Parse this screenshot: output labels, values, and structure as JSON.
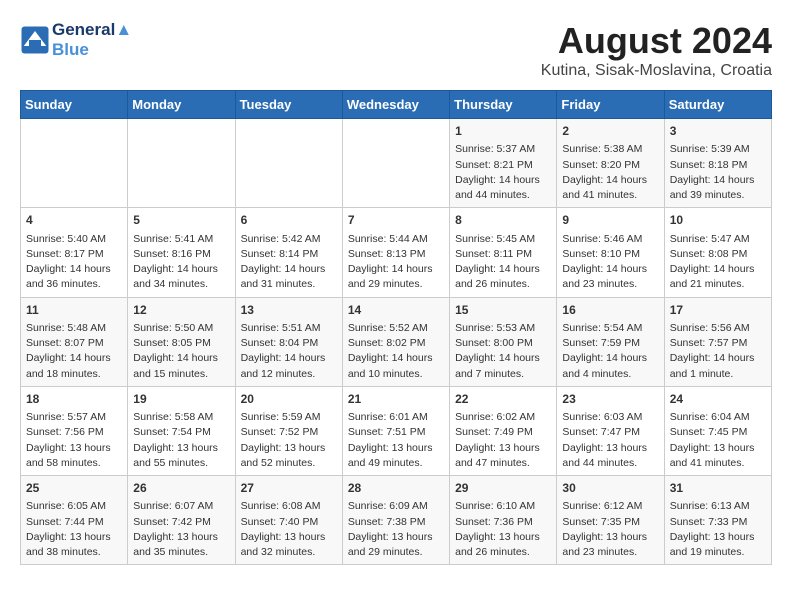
{
  "header": {
    "logo_line1": "General",
    "logo_line2": "Blue",
    "month": "August 2024",
    "location": "Kutina, Sisak-Moslavina, Croatia"
  },
  "days_of_week": [
    "Sunday",
    "Monday",
    "Tuesday",
    "Wednesday",
    "Thursday",
    "Friday",
    "Saturday"
  ],
  "weeks": [
    [
      {
        "day": "",
        "info": ""
      },
      {
        "day": "",
        "info": ""
      },
      {
        "day": "",
        "info": ""
      },
      {
        "day": "",
        "info": ""
      },
      {
        "day": "1",
        "info": "Sunrise: 5:37 AM\nSunset: 8:21 PM\nDaylight: 14 hours\nand 44 minutes."
      },
      {
        "day": "2",
        "info": "Sunrise: 5:38 AM\nSunset: 8:20 PM\nDaylight: 14 hours\nand 41 minutes."
      },
      {
        "day": "3",
        "info": "Sunrise: 5:39 AM\nSunset: 8:18 PM\nDaylight: 14 hours\nand 39 minutes."
      }
    ],
    [
      {
        "day": "4",
        "info": "Sunrise: 5:40 AM\nSunset: 8:17 PM\nDaylight: 14 hours\nand 36 minutes."
      },
      {
        "day": "5",
        "info": "Sunrise: 5:41 AM\nSunset: 8:16 PM\nDaylight: 14 hours\nand 34 minutes."
      },
      {
        "day": "6",
        "info": "Sunrise: 5:42 AM\nSunset: 8:14 PM\nDaylight: 14 hours\nand 31 minutes."
      },
      {
        "day": "7",
        "info": "Sunrise: 5:44 AM\nSunset: 8:13 PM\nDaylight: 14 hours\nand 29 minutes."
      },
      {
        "day": "8",
        "info": "Sunrise: 5:45 AM\nSunset: 8:11 PM\nDaylight: 14 hours\nand 26 minutes."
      },
      {
        "day": "9",
        "info": "Sunrise: 5:46 AM\nSunset: 8:10 PM\nDaylight: 14 hours\nand 23 minutes."
      },
      {
        "day": "10",
        "info": "Sunrise: 5:47 AM\nSunset: 8:08 PM\nDaylight: 14 hours\nand 21 minutes."
      }
    ],
    [
      {
        "day": "11",
        "info": "Sunrise: 5:48 AM\nSunset: 8:07 PM\nDaylight: 14 hours\nand 18 minutes."
      },
      {
        "day": "12",
        "info": "Sunrise: 5:50 AM\nSunset: 8:05 PM\nDaylight: 14 hours\nand 15 minutes."
      },
      {
        "day": "13",
        "info": "Sunrise: 5:51 AM\nSunset: 8:04 PM\nDaylight: 14 hours\nand 12 minutes."
      },
      {
        "day": "14",
        "info": "Sunrise: 5:52 AM\nSunset: 8:02 PM\nDaylight: 14 hours\nand 10 minutes."
      },
      {
        "day": "15",
        "info": "Sunrise: 5:53 AM\nSunset: 8:00 PM\nDaylight: 14 hours\nand 7 minutes."
      },
      {
        "day": "16",
        "info": "Sunrise: 5:54 AM\nSunset: 7:59 PM\nDaylight: 14 hours\nand 4 minutes."
      },
      {
        "day": "17",
        "info": "Sunrise: 5:56 AM\nSunset: 7:57 PM\nDaylight: 14 hours\nand 1 minute."
      }
    ],
    [
      {
        "day": "18",
        "info": "Sunrise: 5:57 AM\nSunset: 7:56 PM\nDaylight: 13 hours\nand 58 minutes."
      },
      {
        "day": "19",
        "info": "Sunrise: 5:58 AM\nSunset: 7:54 PM\nDaylight: 13 hours\nand 55 minutes."
      },
      {
        "day": "20",
        "info": "Sunrise: 5:59 AM\nSunset: 7:52 PM\nDaylight: 13 hours\nand 52 minutes."
      },
      {
        "day": "21",
        "info": "Sunrise: 6:01 AM\nSunset: 7:51 PM\nDaylight: 13 hours\nand 49 minutes."
      },
      {
        "day": "22",
        "info": "Sunrise: 6:02 AM\nSunset: 7:49 PM\nDaylight: 13 hours\nand 47 minutes."
      },
      {
        "day": "23",
        "info": "Sunrise: 6:03 AM\nSunset: 7:47 PM\nDaylight: 13 hours\nand 44 minutes."
      },
      {
        "day": "24",
        "info": "Sunrise: 6:04 AM\nSunset: 7:45 PM\nDaylight: 13 hours\nand 41 minutes."
      }
    ],
    [
      {
        "day": "25",
        "info": "Sunrise: 6:05 AM\nSunset: 7:44 PM\nDaylight: 13 hours\nand 38 minutes."
      },
      {
        "day": "26",
        "info": "Sunrise: 6:07 AM\nSunset: 7:42 PM\nDaylight: 13 hours\nand 35 minutes."
      },
      {
        "day": "27",
        "info": "Sunrise: 6:08 AM\nSunset: 7:40 PM\nDaylight: 13 hours\nand 32 minutes."
      },
      {
        "day": "28",
        "info": "Sunrise: 6:09 AM\nSunset: 7:38 PM\nDaylight: 13 hours\nand 29 minutes."
      },
      {
        "day": "29",
        "info": "Sunrise: 6:10 AM\nSunset: 7:36 PM\nDaylight: 13 hours\nand 26 minutes."
      },
      {
        "day": "30",
        "info": "Sunrise: 6:12 AM\nSunset: 7:35 PM\nDaylight: 13 hours\nand 23 minutes."
      },
      {
        "day": "31",
        "info": "Sunrise: 6:13 AM\nSunset: 7:33 PM\nDaylight: 13 hours\nand 19 minutes."
      }
    ]
  ]
}
